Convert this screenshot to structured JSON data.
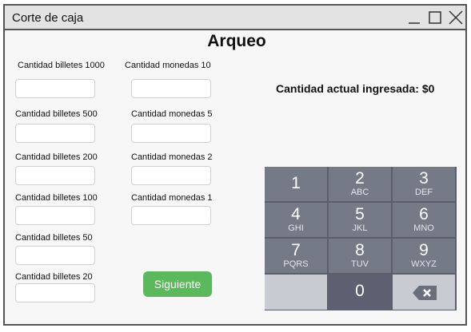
{
  "window": {
    "title": "Corte de caja",
    "controls": [
      "minimize-icon",
      "maximize-icon",
      "close-icon"
    ]
  },
  "main": {
    "heading": "Arqueo",
    "status_text": "Cantidad actual ingresada: $0",
    "next_button": "Siguiente"
  },
  "bills": [
    {
      "label": "Cantidad billetes 1000",
      "value": ""
    },
    {
      "label": "Cantidad billetes 500",
      "value": ""
    },
    {
      "label": "Cantidad billetes 200",
      "value": ""
    },
    {
      "label": "Cantidad billetes 100",
      "value": ""
    },
    {
      "label": "Cantidad billetes 50",
      "value": ""
    },
    {
      "label": "Cantidad billetes 20",
      "value": ""
    }
  ],
  "coins": [
    {
      "label": "Cantidad monedas 10",
      "value": ""
    },
    {
      "label": "Cantidad monedas 5",
      "value": ""
    },
    {
      "label": "Cantidad monedas 2",
      "value": ""
    },
    {
      "label": "Cantidad monedas 1",
      "value": ""
    }
  ],
  "keypad": {
    "keys": [
      {
        "num": "1",
        "letters": ""
      },
      {
        "num": "2",
        "letters": "ABC"
      },
      {
        "num": "3",
        "letters": "DEF"
      },
      {
        "num": "4",
        "letters": "GHI"
      },
      {
        "num": "5",
        "letters": "JKL"
      },
      {
        "num": "6",
        "letters": "MNO"
      },
      {
        "num": "7",
        "letters": "PQRS"
      },
      {
        "num": "8",
        "letters": "TUV"
      },
      {
        "num": "9",
        "letters": "WXYZ"
      },
      {
        "num": "",
        "letters": ""
      },
      {
        "num": "0",
        "letters": ""
      },
      {
        "num": "",
        "letters": "",
        "icon": "backspace-icon"
      }
    ]
  },
  "colors": {
    "next_button": "#5cb85c",
    "keypad_key": "#757a87",
    "keypad_light": "#c8cbd1"
  }
}
